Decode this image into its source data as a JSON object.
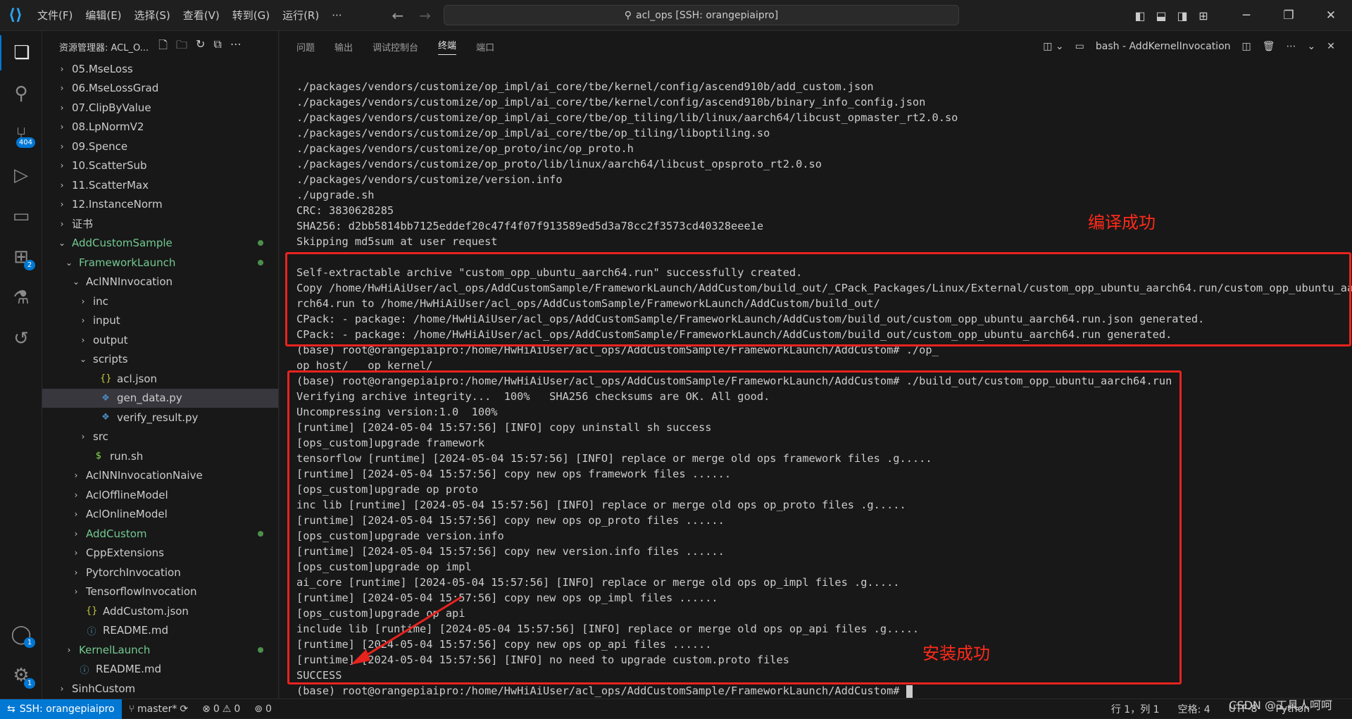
{
  "menu": [
    "文件(F)",
    "编辑(E)",
    "选择(S)",
    "查看(V)",
    "转到(G)",
    "运行(R)",
    "···"
  ],
  "command_center": "acl_ops [SSH: orangepiaipro]",
  "sidebar": {
    "title": "资源管理器: ACL_O...",
    "rows": [
      {
        "label": "05.MseLoss",
        "indent": 0,
        "chev": "›",
        "icon": ""
      },
      {
        "label": "06.MseLossGrad",
        "indent": 0,
        "chev": "›",
        "icon": ""
      },
      {
        "label": "07.ClipByValue",
        "indent": 0,
        "chev": "›",
        "icon": ""
      },
      {
        "label": "08.LpNormV2",
        "indent": 0,
        "chev": "›",
        "icon": ""
      },
      {
        "label": "09.Spence",
        "indent": 0,
        "chev": "›",
        "icon": ""
      },
      {
        "label": "10.ScatterSub",
        "indent": 0,
        "chev": "›",
        "icon": ""
      },
      {
        "label": "11.ScatterMax",
        "indent": 0,
        "chev": "›",
        "icon": ""
      },
      {
        "label": "12.InstanceNorm",
        "indent": 0,
        "chev": "›",
        "icon": ""
      },
      {
        "label": "证书",
        "indent": 0,
        "chev": "›",
        "icon": ""
      },
      {
        "label": "AddCustomSample",
        "indent": 0,
        "chev": "⌄",
        "icon": "",
        "green": true
      },
      {
        "label": "FrameworkLaunch",
        "indent": 1,
        "chev": "⌄",
        "icon": "",
        "green": true
      },
      {
        "label": "AclNNInvocation",
        "indent": 2,
        "chev": "⌄",
        "icon": ""
      },
      {
        "label": "inc",
        "indent": 3,
        "chev": "›",
        "icon": ""
      },
      {
        "label": "input",
        "indent": 3,
        "chev": "›",
        "icon": ""
      },
      {
        "label": "output",
        "indent": 3,
        "chev": "›",
        "icon": ""
      },
      {
        "label": "scripts",
        "indent": 3,
        "chev": "⌄",
        "icon": ""
      },
      {
        "label": "acl.json",
        "indent": 4,
        "chev": "",
        "icon": "{}"
      },
      {
        "label": "gen_data.py",
        "indent": 4,
        "chev": "",
        "icon": "py",
        "selected": true
      },
      {
        "label": "verify_result.py",
        "indent": 4,
        "chev": "",
        "icon": "py"
      },
      {
        "label": "src",
        "indent": 3,
        "chev": "›",
        "icon": ""
      },
      {
        "label": "run.sh",
        "indent": 3,
        "chev": "",
        "icon": "$"
      },
      {
        "label": "AclNNInvocationNaive",
        "indent": 2,
        "chev": "›",
        "icon": ""
      },
      {
        "label": "AclOfflineModel",
        "indent": 2,
        "chev": "›",
        "icon": ""
      },
      {
        "label": "AclOnlineModel",
        "indent": 2,
        "chev": "›",
        "icon": ""
      },
      {
        "label": "AddCustom",
        "indent": 2,
        "chev": "›",
        "icon": "",
        "green": true
      },
      {
        "label": "CppExtensions",
        "indent": 2,
        "chev": "›",
        "icon": ""
      },
      {
        "label": "PytorchInvocation",
        "indent": 2,
        "chev": "›",
        "icon": ""
      },
      {
        "label": "TensorflowInvocation",
        "indent": 2,
        "chev": "›",
        "icon": ""
      },
      {
        "label": "AddCustom.json",
        "indent": 2,
        "chev": "",
        "icon": "{}"
      },
      {
        "label": "README.md",
        "indent": 2,
        "chev": "",
        "icon": "ⓘ"
      },
      {
        "label": "KernelLaunch",
        "indent": 1,
        "chev": "›",
        "icon": "",
        "green": true
      },
      {
        "label": "README.md",
        "indent": 1,
        "chev": "",
        "icon": "ⓘ"
      },
      {
        "label": "SinhCustom",
        "indent": 0,
        "chev": "›",
        "icon": ""
      }
    ]
  },
  "activity_badges": {
    "scm": "404",
    "extensions": "2",
    "accounts": "1",
    "settings": "1"
  },
  "panel": {
    "tabs": [
      "问题",
      "输出",
      "调试控制台",
      "终端",
      "端口"
    ],
    "active_tab": "终端",
    "terminal_title": "bash - AddKernelInvocation"
  },
  "terminal_lines": [
    "./packages/vendors/customize/op_impl/ai_core/tbe/kernel/config/ascend910b/add_custom.json",
    "./packages/vendors/customize/op_impl/ai_core/tbe/kernel/config/ascend910b/binary_info_config.json",
    "./packages/vendors/customize/op_impl/ai_core/tbe/op_tiling/lib/linux/aarch64/libcust_opmaster_rt2.0.so",
    "./packages/vendors/customize/op_impl/ai_core/tbe/op_tiling/liboptiling.so",
    "./packages/vendors/customize/op_proto/inc/op_proto.h",
    "./packages/vendors/customize/op_proto/lib/linux/aarch64/libcust_opsproto_rt2.0.so",
    "./packages/vendors/customize/version.info",
    "./upgrade.sh",
    "CRC: 3830628285",
    "SHA256: d2bb5814bb7125eddef20c47f4f07f913589ed5d3a78cc2f3573cd40328eee1e",
    "Skipping md5sum at user request",
    "",
    "Self-extractable archive \"custom_opp_ubuntu_aarch64.run\" successfully created.",
    "Copy /home/HwHiAiUser/acl_ops/AddCustomSample/FrameworkLaunch/AddCustom/build_out/_CPack_Packages/Linux/External/custom_opp_ubuntu_aarch64.run/custom_opp_ubuntu_aa",
    "rch64.run to /home/HwHiAiUser/acl_ops/AddCustomSample/FrameworkLaunch/AddCustom/build_out/",
    "CPack: - package: /home/HwHiAiUser/acl_ops/AddCustomSample/FrameworkLaunch/AddCustom/build_out/custom_opp_ubuntu_aarch64.run.json generated.",
    "CPack: - package: /home/HwHiAiUser/acl_ops/AddCustomSample/FrameworkLaunch/AddCustom/build_out/custom_opp_ubuntu_aarch64.run generated.",
    "(base) root@orangepiaipro:/home/HwHiAiUser/acl_ops/AddCustomSample/FrameworkLaunch/AddCustom# ./op_",
    "op_host/   op_kernel/",
    "(base) root@orangepiaipro:/home/HwHiAiUser/acl_ops/AddCustomSample/FrameworkLaunch/AddCustom# ./build_out/custom_opp_ubuntu_aarch64.run",
    "Verifying archive integrity...  100%   SHA256 checksums are OK. All good.",
    "Uncompressing version:1.0  100%",
    "[runtime] [2024-05-04 15:57:56] [INFO] copy uninstall sh success",
    "[ops_custom]upgrade framework",
    "tensorflow [runtime] [2024-05-04 15:57:56] [INFO] replace or merge old ops framework files .g.....",
    "[runtime] [2024-05-04 15:57:56] copy new ops framework files ......",
    "[ops_custom]upgrade op proto",
    "inc lib [runtime] [2024-05-04 15:57:56] [INFO] replace or merge old ops op_proto files .g.....",
    "[runtime] [2024-05-04 15:57:56] copy new ops op_proto files ......",
    "[ops_custom]upgrade version.info",
    "[runtime] [2024-05-04 15:57:56] copy new version.info files ......",
    "[ops_custom]upgrade op impl",
    "ai_core [runtime] [2024-05-04 15:57:56] [INFO] replace or merge old ops op_impl files .g.....",
    "[runtime] [2024-05-04 15:57:56] copy new ops op_impl files ......",
    "[ops_custom]upgrade op api",
    "include lib [runtime] [2024-05-04 15:57:56] [INFO] replace or merge old ops op_api files .g.....",
    "[runtime] [2024-05-04 15:57:56] copy new ops op_api files ......",
    "[runtime] [2024-05-04 15:57:56] [INFO] no need to upgrade custom.proto files",
    "SUCCESS",
    "(base) root@orangepiaipro:/home/HwHiAiUser/acl_ops/AddCustomSample/FrameworkLaunch/AddCustom# "
  ],
  "annotations": {
    "compile": "编译成功",
    "install": "安装成功"
  },
  "statusbar": {
    "remote": "SSH: orangepiaipro",
    "branch": "master*",
    "problems": "0",
    "warnings": "0",
    "ports": "0",
    "position": "行 1，列 1",
    "spaces": "空格: 4",
    "encoding": "UTF-8",
    "language": "Python"
  },
  "watermark": "CSDN @工具人呵呵",
  "colors": {
    "accent": "#0078d4",
    "annotation": "#e8231e",
    "modified": "#73c991"
  }
}
